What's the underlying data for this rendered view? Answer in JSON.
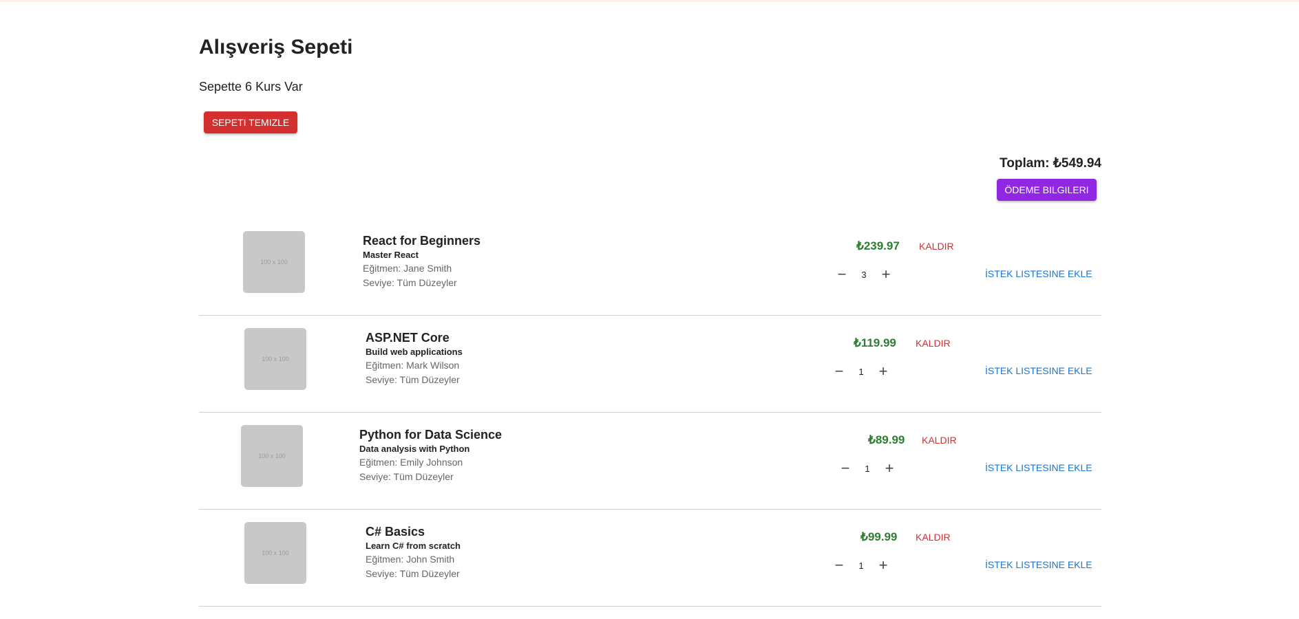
{
  "page": {
    "title": "Alışveriş Sepeti",
    "course_count_text": "Sepette 6 Kurs Var",
    "clear_cart_label": "SEPETI TEMIZLE",
    "total_label": "Toplam: ₺549.94",
    "checkout_label": "ÖDEME BILGILERI"
  },
  "colors": {
    "danger": "#d32f2f",
    "checkout": "#9027e3",
    "price": "#2e7d32",
    "link": "#1976d2",
    "thumbnail_bg": "#c8c8c8"
  },
  "icons": {
    "decrease": "minus-icon",
    "increase": "plus-icon"
  },
  "cart": {
    "items": [
      {
        "thumbnail_text": "100 x 100",
        "title": "React for Beginners",
        "subtitle": "Master React",
        "instructor": "Eğitmen: Jane Smith",
        "level": "Seviye: Tüm Düzeyler",
        "price": "₺239.97",
        "remove_label": "KALDIR",
        "quantity": "3",
        "wishlist_label": "İSTEK LISTESINE EKLE"
      },
      {
        "thumbnail_text": "100 x 100",
        "title": "ASP.NET Core",
        "subtitle": "Build web applications",
        "instructor": "Eğitmen: Mark Wilson",
        "level": "Seviye: Tüm Düzeyler",
        "price": "₺119.99",
        "remove_label": "KALDIR",
        "quantity": "1",
        "wishlist_label": "İSTEK LISTESINE EKLE"
      },
      {
        "thumbnail_text": "100 x 100",
        "title": "Python for Data Science",
        "subtitle": "Data analysis with Python",
        "instructor": "Eğitmen: Emily Johnson",
        "level": "Seviye: Tüm Düzeyler",
        "price": "₺89.99",
        "remove_label": "KALDIR",
        "quantity": "1",
        "wishlist_label": "İSTEK LISTESINE EKLE"
      },
      {
        "thumbnail_text": "100 x 100",
        "title": "C# Basics",
        "subtitle": "Learn C# from scratch",
        "instructor": "Eğitmen: John Smith",
        "level": "Seviye: Tüm Düzeyler",
        "price": "₺99.99",
        "remove_label": "KALDIR",
        "quantity": "1",
        "wishlist_label": "İSTEK LISTESINE EKLE"
      }
    ]
  }
}
